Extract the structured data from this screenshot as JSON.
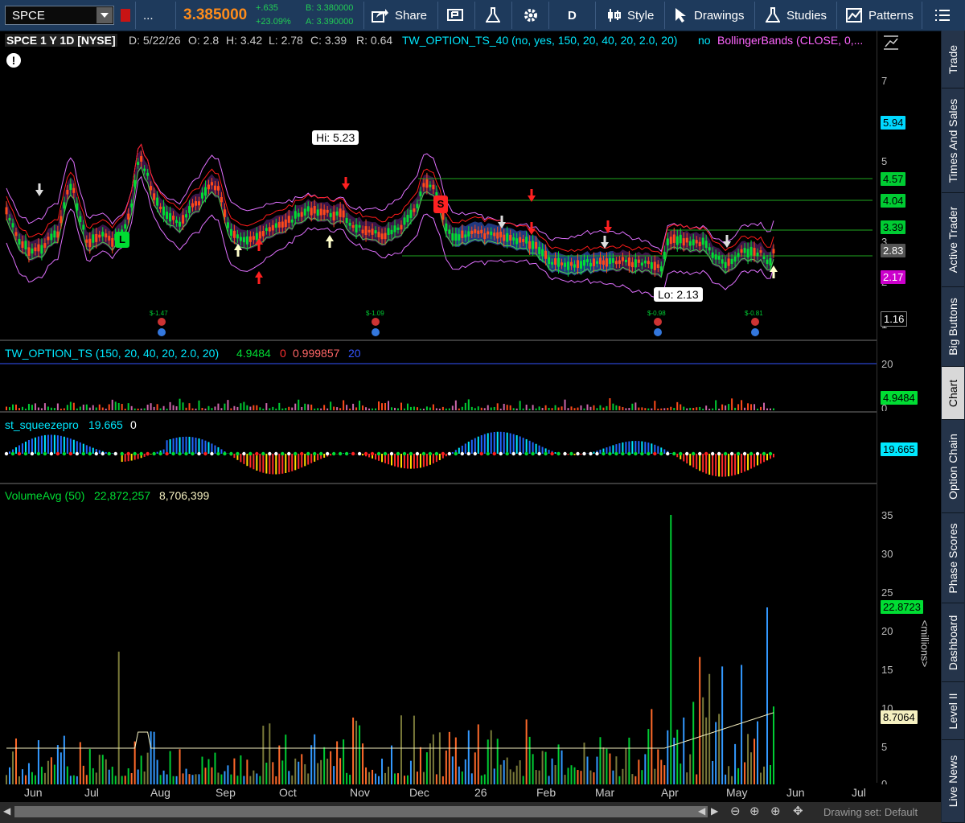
{
  "toolbar": {
    "symbol": "SPCE",
    "more_label": "...",
    "last_price": "3.385000",
    "change_abs": "+.635",
    "change_pct": "+23.09%",
    "bid": "B: 3.380000",
    "ask": "A: 3.390000",
    "share_label": "Share",
    "aggregation": "D",
    "style_label": "Style",
    "drawings_label": "Drawings",
    "studies_label": "Studies",
    "patterns_label": "Patterns"
  },
  "header": {
    "symbol_period": "SPCE 1 Y 1D [NYSE]",
    "date": "D: 5/22/26",
    "open": "O: 2.8",
    "high": "H: 3.42",
    "low": "L: 2.78",
    "close": "C: 3.39",
    "range": "R: 0.64",
    "study1": "TW_OPTION_TS_40 (no, yes, 150, 20, 40, 20, 2.0, 20)",
    "study1_flag": "no",
    "study2": "BollingerBands (CLOSE, 0,..."
  },
  "price_panel": {
    "axis_ticks": [
      "7",
      "5",
      "3",
      "2",
      "1"
    ],
    "labels": [
      {
        "text": "5.94",
        "color": "#00d8ff"
      },
      {
        "text": "4.57",
        "color": "#00cc33"
      },
      {
        "text": "4.04",
        "color": "#00cc33"
      },
      {
        "text": "3.39",
        "color": "#00cc33"
      },
      {
        "text": "2.83",
        "color": "#555555"
      },
      {
        "text": "2.17",
        "color": "#cc00cc"
      },
      {
        "text": "1.16",
        "color": "#000000"
      }
    ],
    "hi_callout": "Hi: 5.23",
    "lo_callout": "Lo: 2.13",
    "long_marker": "L",
    "short_marker": "S",
    "dividends": [
      "$-1.47",
      "$-1.09",
      "$-0.98",
      "$-0.81"
    ]
  },
  "option_panel": {
    "title": "TW_OPTION_TS (150, 20, 40, 20, 2.0, 20)",
    "v1": "4.9484",
    "v2": "0",
    "v3": "0.999857",
    "v4": "20",
    "axis_top": "20",
    "axis_bottom": "0",
    "label": "4.9484"
  },
  "squeeze_panel": {
    "title": "st_squeezepro",
    "v1": "19.665",
    "v2": "0",
    "label": "19.665"
  },
  "volume_panel": {
    "title": "VolumeAvg (50)",
    "v1": "22,872,257",
    "v2": "8,706,399",
    "axis_ticks": [
      "35",
      "30",
      "25",
      "20",
      "15",
      "10",
      "5",
      "0"
    ],
    "label_volume": "22.8723",
    "label_avg": "8.7064",
    "units": "<millions>"
  },
  "months": [
    "Jun",
    "Jul",
    "Aug",
    "Sep",
    "Oct",
    "Nov",
    "Dec",
    "26",
    "Feb",
    "Mar",
    "Apr",
    "May",
    "Jun",
    "Jul"
  ],
  "status": {
    "drawing_set": "Drawing set: Default"
  },
  "side_tabs": [
    "Trade",
    "Times And Sales",
    "Active Trader",
    "Big Buttons",
    "Chart",
    "Option Chain",
    "Phase Scores",
    "Dashboard",
    "Level II",
    "Live News"
  ],
  "colors": {
    "up": "#00cc33",
    "down": "#ff2200",
    "toolbar": "#1e3a5c",
    "price_last": "#ff8c1a"
  }
}
